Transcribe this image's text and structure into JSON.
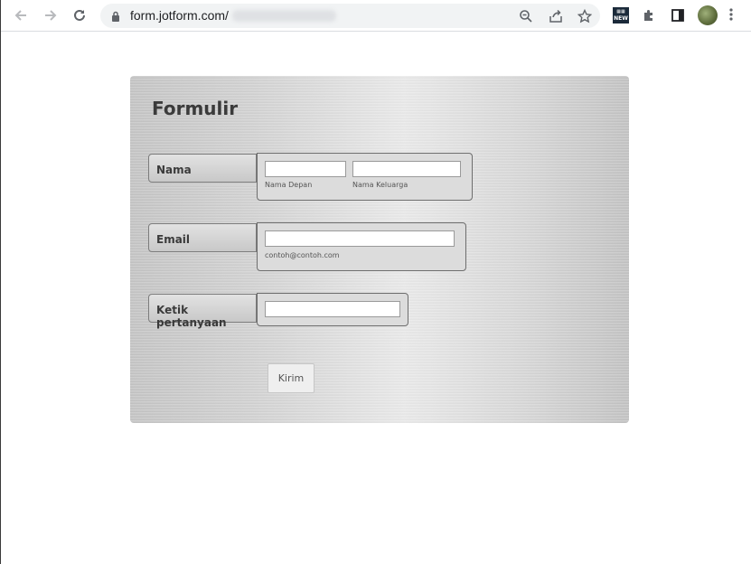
{
  "browser": {
    "url": "form.jotform.com/",
    "extension_badge": "NEW",
    "colors": {
      "toolbar_bg": "#ffffff",
      "omnibox_bg": "#f1f3f4",
      "icon": "#5f6368"
    }
  },
  "form": {
    "title": "Formulir",
    "fields": [
      {
        "label": "Nama",
        "inputs": [
          {
            "value": "",
            "sublabel": "Nama Depan"
          },
          {
            "value": "",
            "sublabel": "Nama Keluarga"
          }
        ]
      },
      {
        "label": "Email",
        "inputs": [
          {
            "value": "",
            "sublabel": "contoh@contoh.com"
          }
        ]
      },
      {
        "label": "Ketik pertanyaan",
        "inputs": [
          {
            "value": ""
          }
        ]
      }
    ],
    "submit_label": "Kirim"
  }
}
